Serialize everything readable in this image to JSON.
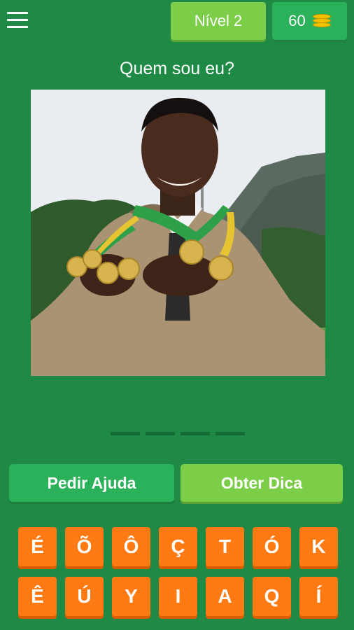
{
  "header": {
    "level_label": "Nível 2",
    "coins": "60",
    "menu_icon": "hamburger-menu-icon",
    "coin_icon": "coin-stack-icon"
  },
  "question": {
    "title": "Quem sou eu?",
    "answer_length": 4
  },
  "actions": {
    "help_label": "Pedir Ajuda",
    "hint_label": "Obter Dica"
  },
  "keyboard": {
    "row1": [
      "É",
      "Õ",
      "Ô",
      "Ç",
      "T",
      "Ó",
      "K"
    ],
    "row2": [
      "Ê",
      "Ú",
      "Y",
      "I",
      "A",
      "Q",
      "Í"
    ]
  },
  "colors": {
    "background": "#1f8a45",
    "level_button": "#7ccd47",
    "coins_button": "#2bb159",
    "key": "#ff7a12"
  }
}
